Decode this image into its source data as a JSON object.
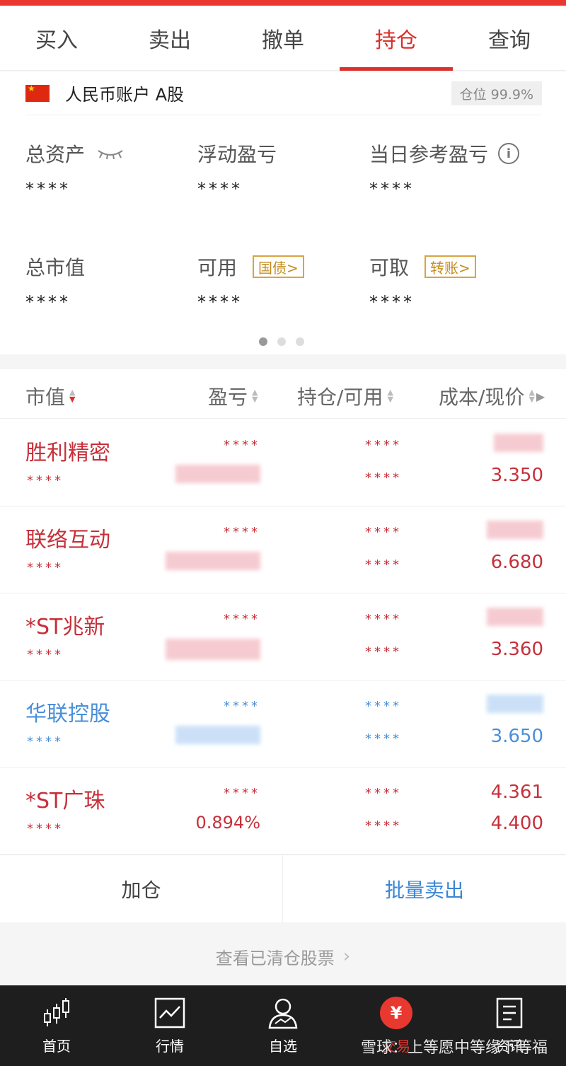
{
  "tabs": [
    {
      "label": "买入"
    },
    {
      "label": "卖出"
    },
    {
      "label": "撤单"
    },
    {
      "label": "持仓"
    },
    {
      "label": "查询"
    }
  ],
  "account": {
    "name": "人民币账户 A股",
    "position_label": "仓位 99.9%",
    "metrics": {
      "total_assets": {
        "label": "总资产",
        "value": "****"
      },
      "float_pnl": {
        "label": "浮动盈亏",
        "value": "****"
      },
      "daily_pnl": {
        "label": "当日参考盈亏",
        "value": "****"
      },
      "market_value": {
        "label": "总市值",
        "value": "****"
      },
      "available": {
        "label": "可用",
        "value": "****",
        "button": "国债>"
      },
      "withdrawable": {
        "label": "可取",
        "value": "****",
        "button": "转账>"
      }
    }
  },
  "holdings": {
    "headers": {
      "market_value": "市值",
      "pnl": "盈亏",
      "position": "持仓/可用",
      "cost_price": "成本/现价"
    },
    "rows": [
      {
        "name": "胜利精密",
        "value": "****",
        "pnl": "****",
        "pnl_pct": "",
        "position": "****",
        "available": "****",
        "cost": "",
        "price": "3.350",
        "tone": "red"
      },
      {
        "name": "联络互动",
        "value": "****",
        "pnl": "****",
        "pnl_pct": "",
        "position": "****",
        "available": "****",
        "cost": "",
        "price": "6.680",
        "tone": "red"
      },
      {
        "name": "*ST兆新",
        "value": "****",
        "pnl": "****",
        "pnl_pct": "",
        "position": "****",
        "available": "****",
        "cost": "",
        "price": "3.360",
        "tone": "red"
      },
      {
        "name": "华联控股",
        "value": "****",
        "pnl": "****",
        "pnl_pct": "",
        "position": "****",
        "available": "****",
        "cost": "",
        "price": "3.650",
        "tone": "blue"
      },
      {
        "name": "*ST广珠",
        "value": "****",
        "pnl": "****",
        "pnl_pct": "0.894%",
        "position": "****",
        "available": "****",
        "cost": "4.361",
        "price": "4.400",
        "tone": "red"
      }
    ]
  },
  "actions": {
    "add": "加仓",
    "batch_sell": "批量卖出"
  },
  "cleared_link": "查看已清仓股票",
  "nav": [
    {
      "label": "首页",
      "icon": "candlestick-icon"
    },
    {
      "label": "行情",
      "icon": "chart-icon"
    },
    {
      "label": "自选",
      "icon": "user-chart-icon"
    },
    {
      "label": "交易",
      "icon": "yen-icon"
    },
    {
      "label": "资讯",
      "icon": "document-icon"
    }
  ],
  "watermark": "雪球：上等愿中等缘下等福",
  "colors": {
    "accent": "#e8382f",
    "up": "#c6303a",
    "down": "#4a8fd8",
    "gold": "#c48b1f"
  }
}
